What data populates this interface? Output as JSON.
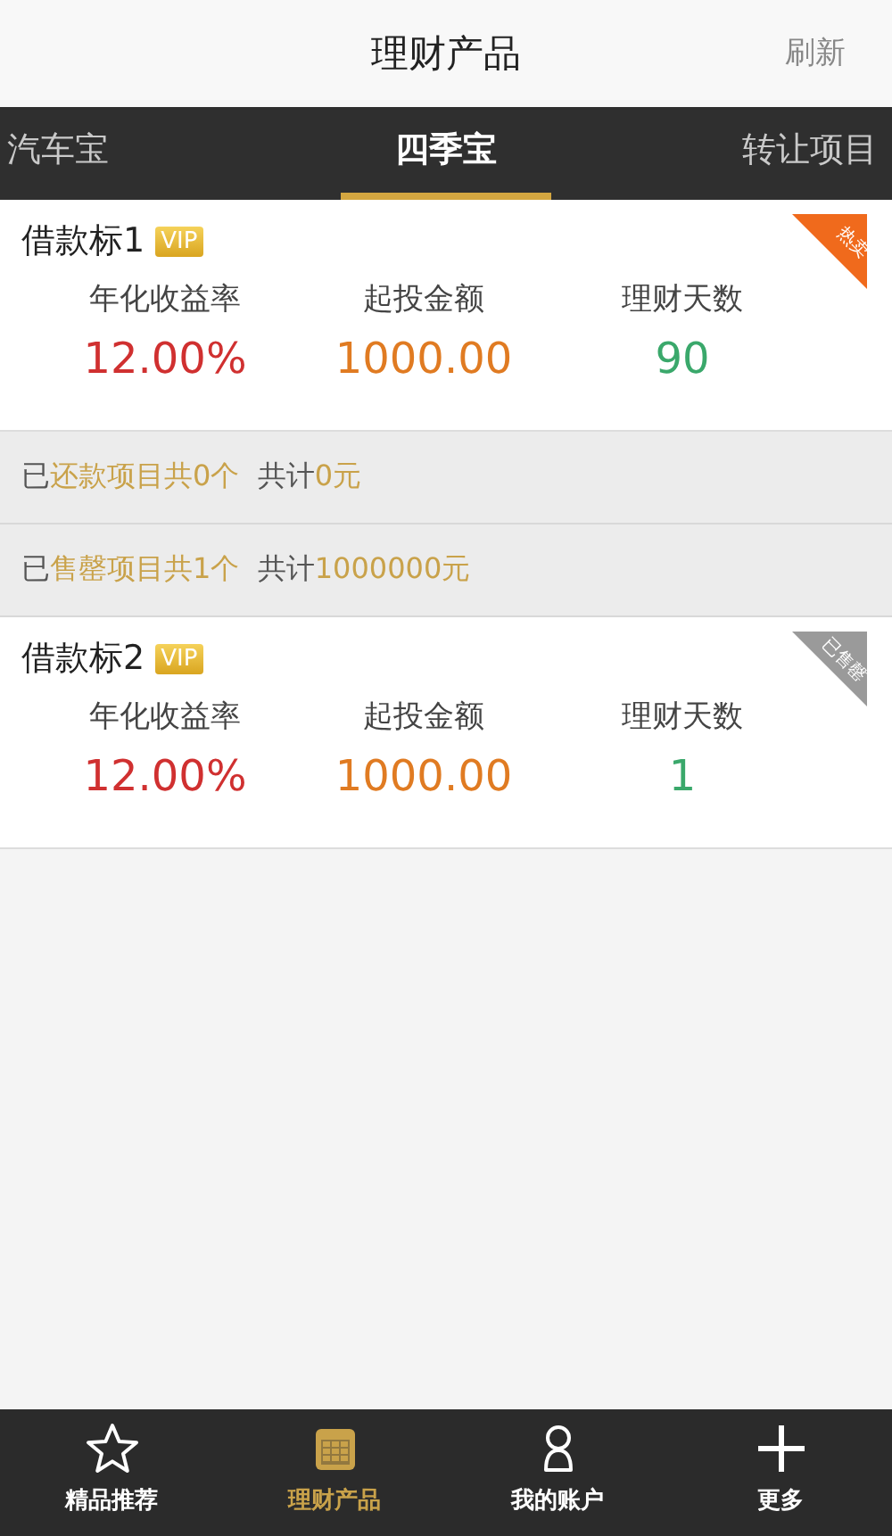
{
  "header": {
    "title": "理财产品",
    "action": "刷新"
  },
  "tabs": [
    {
      "label": "汽车宝",
      "selected": false
    },
    {
      "label": "四季宝",
      "selected": true
    },
    {
      "label": "转让项目",
      "selected": false
    }
  ],
  "products": [
    {
      "name": "借款标1",
      "tag": "VIP",
      "badge": {
        "text": "热卖",
        "color": "#f06a1c"
      },
      "stats": [
        {
          "label": "年化收益率",
          "value": "12.00%",
          "color": "#d03030"
        },
        {
          "label": "起投金额",
          "value": "1000.00",
          "color": "#e07b22"
        },
        {
          "label": "理财天数",
          "value": "90",
          "color": "#3aa86b"
        }
      ]
    },
    {
      "name": "借款标2",
      "tag": "VIP",
      "badge": {
        "text": "已售罄",
        "color": "#9a9a9a"
      },
      "stats": [
        {
          "label": "年化收益率",
          "value": "12.00%",
          "color": "#d03030"
        },
        {
          "label": "起投金额",
          "value": "1000.00",
          "color": "#e07b22"
        },
        {
          "label": "理财天数",
          "value": "1",
          "color": "#3aa86b"
        }
      ]
    }
  ],
  "summaries": [
    [
      {
        "text": "已",
        "highlight": false
      },
      {
        "text": "还款项目共0个",
        "highlight": true
      },
      {
        "text": "  共计",
        "highlight": false
      },
      {
        "text": "0元",
        "highlight": true
      }
    ],
    [
      {
        "text": "已",
        "highlight": false
      },
      {
        "text": "售罄项目共1个",
        "highlight": true
      },
      {
        "text": "  共计",
        "highlight": false
      },
      {
        "text": "1000000元",
        "highlight": true
      }
    ]
  ],
  "bottom_nav": [
    {
      "label": "精品推荐",
      "kind": "star",
      "selected": false
    },
    {
      "label": "理财产品",
      "kind": "calendar",
      "selected": true
    },
    {
      "label": "我的账户",
      "kind": "person",
      "selected": false
    },
    {
      "label": "更多",
      "kind": "plus",
      "selected": false
    }
  ]
}
